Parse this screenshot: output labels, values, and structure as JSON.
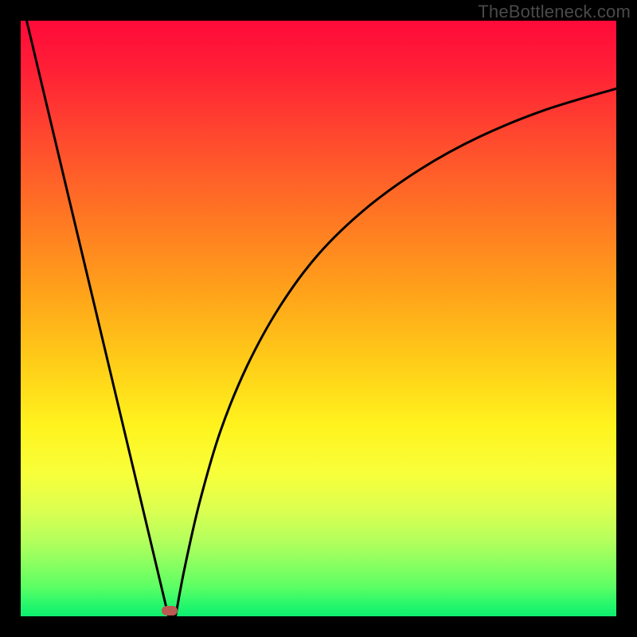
{
  "watermark": "TheBottleneck.com",
  "colors": {
    "background": "#000000",
    "curve": "#000000",
    "marker": "#bb5a52"
  },
  "chart_data": {
    "type": "line",
    "title": "",
    "xlabel": "",
    "ylabel": "",
    "xlim": [
      0,
      1
    ],
    "ylim": [
      0,
      1
    ],
    "grid": false,
    "legend": false,
    "annotations": [
      {
        "label": "marker",
        "x": 0.25,
        "y": 0.01
      }
    ],
    "series": [
      {
        "name": "left-branch",
        "x": [
          0.01,
          0.04,
          0.08,
          0.12,
          0.16,
          0.2,
          0.23,
          0.248
        ],
        "y": [
          1.0,
          0.874,
          0.706,
          0.538,
          0.37,
          0.202,
          0.076,
          0.0
        ]
      },
      {
        "name": "right-branch",
        "x": [
          0.26,
          0.275,
          0.3,
          0.335,
          0.38,
          0.435,
          0.5,
          0.58,
          0.67,
          0.77,
          0.88,
          1.0
        ],
        "y": [
          0.0,
          0.08,
          0.19,
          0.31,
          0.42,
          0.52,
          0.608,
          0.685,
          0.75,
          0.805,
          0.85,
          0.886
        ]
      }
    ]
  }
}
